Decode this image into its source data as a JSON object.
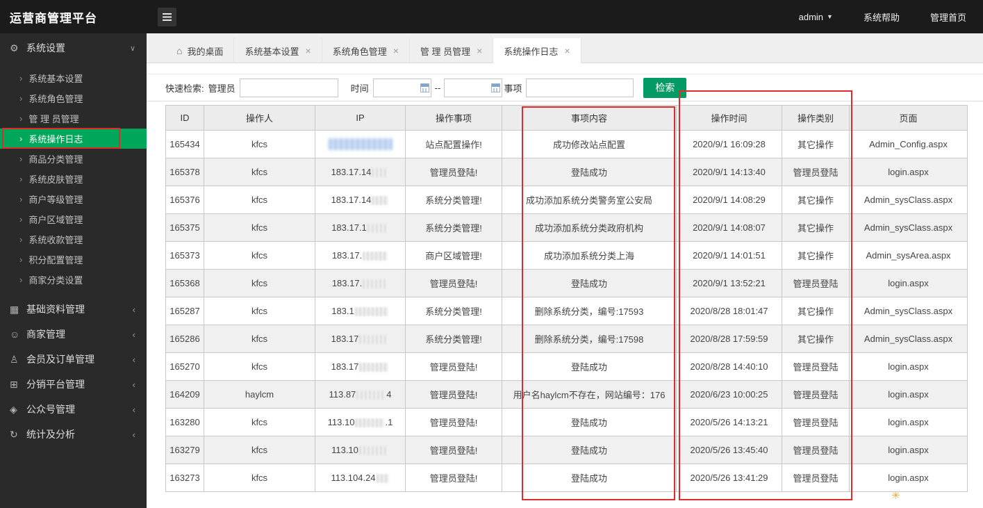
{
  "colors": {
    "accent_green": "#00a65a",
    "button_green": "#029b66",
    "annotation_red": "#e02b2b",
    "header_bg": "#1b1b1b",
    "sidebar_bg": "#2a2a2a"
  },
  "header": {
    "title": "运营商管理平台",
    "user": "admin",
    "help": "系统帮助",
    "home": "管理首页"
  },
  "sidebar": {
    "top_section": {
      "label": "系统设置",
      "icon": "gear-icon"
    },
    "subitems": [
      {
        "label": "系统基本设置"
      },
      {
        "label": "系统角色管理"
      },
      {
        "label": "管 理 员管理"
      },
      {
        "label": "系统操作日志",
        "active": true
      },
      {
        "label": "商品分类管理"
      },
      {
        "label": "系统皮肤管理"
      },
      {
        "label": "商户等级管理"
      },
      {
        "label": "商户区域管理"
      },
      {
        "label": "系统收款管理"
      },
      {
        "label": "积分配置管理"
      },
      {
        "label": "商家分类设置"
      }
    ],
    "sections": [
      {
        "label": "基础资料管理",
        "icon": "grid-icon"
      },
      {
        "label": "商家管理",
        "icon": "merchant-icon"
      },
      {
        "label": "会员及订单管理",
        "icon": "member-icon"
      },
      {
        "label": "分销平台管理",
        "icon": "distribution-icon"
      },
      {
        "label": "公众号管理",
        "icon": "public-account-icon"
      },
      {
        "label": "统计及分析",
        "icon": "stats-icon"
      }
    ]
  },
  "tabs": [
    {
      "label": "我的桌面",
      "home": true
    },
    {
      "label": "系统基本设置",
      "closable": true
    },
    {
      "label": "系统角色管理",
      "closable": true
    },
    {
      "label": "管 理 员管理",
      "closable": true
    },
    {
      "label": "系统操作日志",
      "closable": true,
      "active": true
    }
  ],
  "toolbar": {
    "quick_label": "快速检索:",
    "admin_label": "管理员",
    "admin_value": "",
    "time_label": "时间",
    "time_from": "",
    "time_to": "",
    "range_separator": "--",
    "item_label": "事项",
    "item_value": "",
    "search_button": "检索"
  },
  "table": {
    "columns": [
      "ID",
      "操作人",
      "IP",
      "操作事项",
      "事项内容",
      "操作时间",
      "操作类别",
      "页面"
    ],
    "rows": [
      {
        "id": "165434",
        "operator": "kfcs",
        "ip_prefix": "",
        "ip_suffix": "",
        "event": "站点配置操作!",
        "content": "成功修改站点配置",
        "time": "2020/9/1 16:09:28",
        "category": "其它操作",
        "page": "Admin_Config.aspx"
      },
      {
        "id": "165378",
        "operator": "kfcs",
        "ip_prefix": "183.17.14",
        "ip_suffix": "",
        "event": "管理员登陆!",
        "content": "登陆成功",
        "time": "2020/9/1 14:13:40",
        "category": "管理员登陆",
        "page": "login.aspx"
      },
      {
        "id": "165376",
        "operator": "kfcs",
        "ip_prefix": "183.17.14",
        "ip_suffix": "",
        "event": "系统分类管理!",
        "content": "成功添加系统分类警务室公安局",
        "time": "2020/9/1 14:08:29",
        "category": "其它操作",
        "page": "Admin_sysClass.aspx"
      },
      {
        "id": "165375",
        "operator": "kfcs",
        "ip_prefix": "183.17.1",
        "ip_suffix": "",
        "event": "系统分类管理!",
        "content": "成功添加系统分类政府机构",
        "time": "2020/9/1 14:08:07",
        "category": "其它操作",
        "page": "Admin_sysClass.aspx"
      },
      {
        "id": "165373",
        "operator": "kfcs",
        "ip_prefix": "183.17.",
        "ip_suffix": "",
        "event": "商户区域管理!",
        "content": "成功添加系统分类上海",
        "time": "2020/9/1 14:01:51",
        "category": "其它操作",
        "page": "Admin_sysArea.aspx"
      },
      {
        "id": "165368",
        "operator": "kfcs",
        "ip_prefix": "183.17.",
        "ip_suffix": "",
        "event": "管理员登陆!",
        "content": "登陆成功",
        "time": "2020/9/1 13:52:21",
        "category": "管理员登陆",
        "page": "login.aspx"
      },
      {
        "id": "165287",
        "operator": "kfcs",
        "ip_prefix": "183.1",
        "ip_suffix": "",
        "event": "系统分类管理!",
        "content": "删除系统分类，编号:17593",
        "time": "2020/8/28 18:01:47",
        "category": "其它操作",
        "page": "Admin_sysClass.aspx"
      },
      {
        "id": "165286",
        "operator": "kfcs",
        "ip_prefix": "183.17",
        "ip_suffix": "",
        "event": "系统分类管理!",
        "content": "删除系统分类，编号:17598",
        "time": "2020/8/28 17:59:59",
        "category": "其它操作",
        "page": "Admin_sysClass.aspx"
      },
      {
        "id": "165270",
        "operator": "kfcs",
        "ip_prefix": "183.17",
        "ip_suffix": "",
        "event": "管理员登陆!",
        "content": "登陆成功",
        "time": "2020/8/28 14:40:10",
        "category": "管理员登陆",
        "page": "login.aspx"
      },
      {
        "id": "164209",
        "operator": "haylcm",
        "ip_prefix": "113.87",
        "ip_suffix": "4",
        "event": "管理员登陆!",
        "content": "用户名haylcm不存在，网站编号：176",
        "time": "2020/6/23 10:00:25",
        "category": "管理员登陆",
        "page": "login.aspx"
      },
      {
        "id": "163280",
        "operator": "kfcs",
        "ip_prefix": "113.10",
        "ip_suffix": ".1",
        "event": "管理员登陆!",
        "content": "登陆成功",
        "time": "2020/5/26 14:13:21",
        "category": "管理员登陆",
        "page": "login.aspx"
      },
      {
        "id": "163279",
        "operator": "kfcs",
        "ip_prefix": "113.10",
        "ip_suffix": "",
        "event": "管理员登陆!",
        "content": "登陆成功",
        "time": "2020/5/26 13:45:40",
        "category": "管理员登陆",
        "page": "login.aspx"
      },
      {
        "id": "163273",
        "operator": "kfcs",
        "ip_prefix": "113.104.24",
        "ip_suffix": "",
        "event": "管理员登陆!",
        "content": "登陆成功",
        "time": "2020/5/26 13:41:29",
        "category": "管理员登陆",
        "page": "login.aspx"
      }
    ]
  }
}
